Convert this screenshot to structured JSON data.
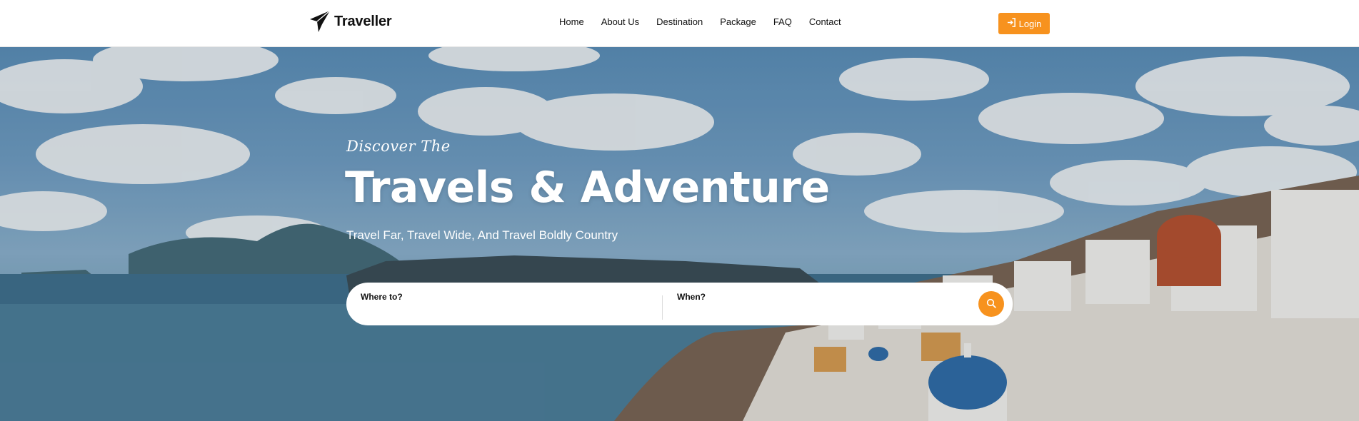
{
  "brand": {
    "name": "Traveller",
    "icon": "paper-plane-icon"
  },
  "nav": {
    "items": [
      {
        "label": "Home"
      },
      {
        "label": "About Us"
      },
      {
        "label": "Destination"
      },
      {
        "label": "Package"
      },
      {
        "label": "FAQ"
      },
      {
        "label": "Contact"
      }
    ],
    "login_label": "Login",
    "login_icon": "sign-in-icon"
  },
  "hero": {
    "kicker": "Discover The",
    "title": "Travels & Adventure",
    "subtitle": "Travel Far, Travel Wide, And Travel Boldly Country",
    "background": "santorini-coastline-photo"
  },
  "search": {
    "where_label": "Where to?",
    "where_value": "",
    "when_label": "When?",
    "when_value": "",
    "button_icon": "search-icon"
  },
  "colors": {
    "accent": "#f7921e",
    "nav_background": "#ffffff",
    "text": "#111111"
  }
}
